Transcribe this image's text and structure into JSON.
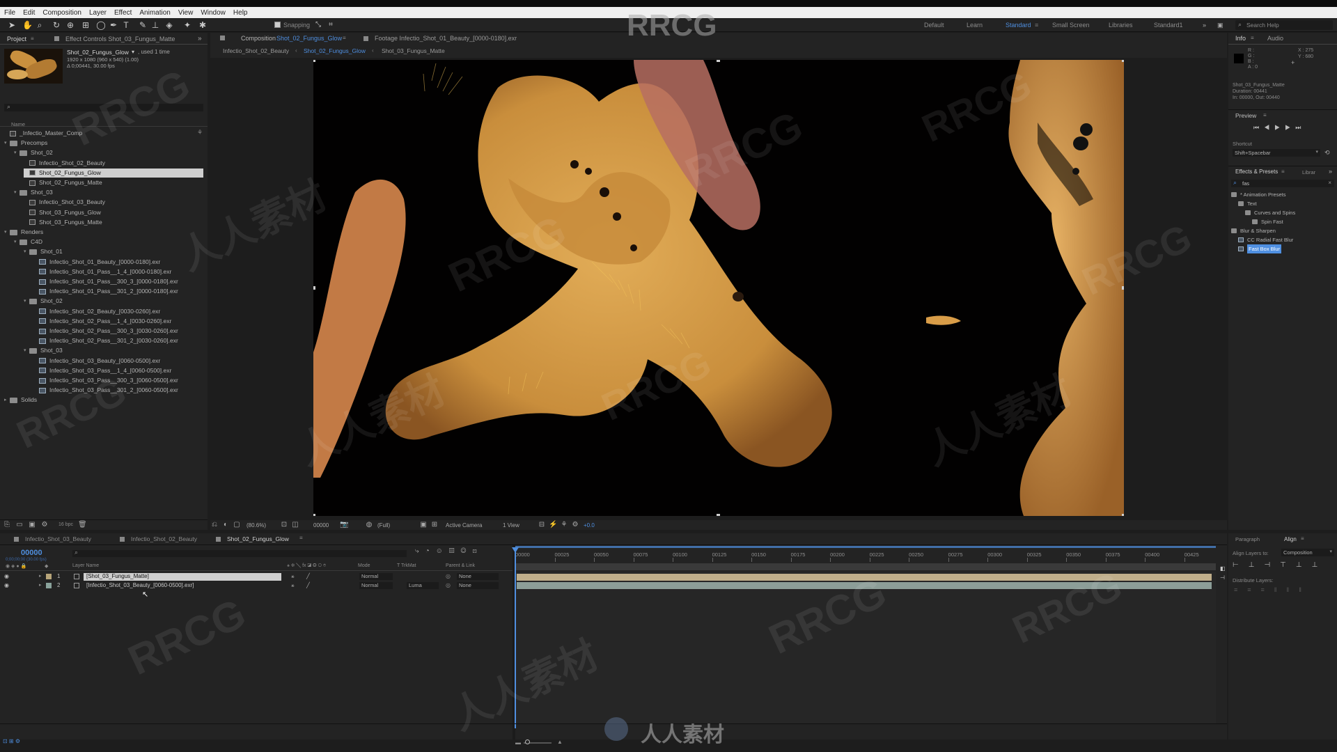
{
  "menu": [
    "File",
    "Edit",
    "Composition",
    "Layer",
    "Effect",
    "Animation",
    "View",
    "Window",
    "Help"
  ],
  "toolbar": {
    "snapping_label": "Snapping",
    "workspaces": [
      "Default",
      "Learn",
      "Standard",
      "Small Screen",
      "Libraries",
      "Standard1"
    ],
    "active_workspace": "Standard",
    "search_help_placeholder": "Search Help"
  },
  "project_panel": {
    "tab_project": "Project",
    "tab_effect_controls": "Effect Controls Shot_03_Fungus_Matte",
    "selected_item": {
      "name": "Shot_02_Fungus_Glow",
      "used": ", used 1 time",
      "dims": "1920 x 1080  (960 x 540) (1.00)",
      "duration": "Δ 0;00441, 30.00 fps"
    },
    "column_name": "Name",
    "items": [
      {
        "label": "_Infectio_Master_Comp",
        "kind": "comp",
        "indent": 0
      },
      {
        "label": "Precomps",
        "kind": "folder",
        "indent": 0,
        "open": true
      },
      {
        "label": "Shot_02",
        "kind": "folder",
        "indent": 1,
        "open": true
      },
      {
        "label": "Infectio_Shot_02_Beauty",
        "kind": "comp",
        "indent": 2
      },
      {
        "label": "Shot_02_Fungus_Glow",
        "kind": "comp",
        "indent": 2,
        "selected": true
      },
      {
        "label": "Shot_02_Fungus_Matte",
        "kind": "comp",
        "indent": 2
      },
      {
        "label": "Shot_03",
        "kind": "folder",
        "indent": 1,
        "open": true
      },
      {
        "label": "Infectio_Shot_03_Beauty",
        "kind": "comp",
        "indent": 2
      },
      {
        "label": "Shot_03_Fungus_Glow",
        "kind": "comp",
        "indent": 2
      },
      {
        "label": "Shot_03_Fungus_Matte",
        "kind": "comp",
        "indent": 2
      },
      {
        "label": "Renders",
        "kind": "folder",
        "indent": 0,
        "open": true
      },
      {
        "label": "C4D",
        "kind": "folder",
        "indent": 1,
        "open": true
      },
      {
        "label": "Shot_01",
        "kind": "folder",
        "indent": 2,
        "open": true
      },
      {
        "label": "Infectio_Shot_01_Beauty_[0000-0180].exr",
        "kind": "exr",
        "indent": 3
      },
      {
        "label": "Infectio_Shot_01_Pass__1_4_[0000-0180].exr",
        "kind": "exr",
        "indent": 3
      },
      {
        "label": "Infectio_Shot_01_Pass__300_3_[0000-0180].exr",
        "kind": "exr",
        "indent": 3
      },
      {
        "label": "Infectio_Shot_01_Pass__301_2_[0000-0180].exr",
        "kind": "exr",
        "indent": 3
      },
      {
        "label": "Shot_02",
        "kind": "folder",
        "indent": 2,
        "open": true
      },
      {
        "label": "Infectio_Shot_02_Beauty_[0030-0260].exr",
        "kind": "exr",
        "indent": 3
      },
      {
        "label": "Infectio_Shot_02_Pass__1_4_[0030-0260].exr",
        "kind": "exr",
        "indent": 3
      },
      {
        "label": "Infectio_Shot_02_Pass__300_3_[0030-0260].exr",
        "kind": "exr",
        "indent": 3
      },
      {
        "label": "Infectio_Shot_02_Pass__301_2_[0030-0260].exr",
        "kind": "exr",
        "indent": 3
      },
      {
        "label": "Shot_03",
        "kind": "folder",
        "indent": 2,
        "open": true
      },
      {
        "label": "Infectio_Shot_03_Beauty_[0060-0500].exr",
        "kind": "exr",
        "indent": 3
      },
      {
        "label": "Infectio_Shot_03_Pass__1_4_[0060-0500].exr",
        "kind": "exr",
        "indent": 3
      },
      {
        "label": "Infectio_Shot_03_Pass__300_3_[0060-0500].exr",
        "kind": "exr",
        "indent": 3
      },
      {
        "label": "Infectio_Shot_03_Pass__301_2_[0060-0500].exr",
        "kind": "exr",
        "indent": 3
      },
      {
        "label": "Solids",
        "kind": "folder",
        "indent": 0,
        "open": false
      }
    ],
    "bpc": "16 bpc"
  },
  "comp_panel": {
    "tab_comp_prefix": "Composition",
    "tab_comp_name": "Shot_02_Fungus_Glow",
    "tab_footage": "Footage Infectio_Shot_01_Beauty_[0000-0180].exr",
    "breadcrumbs": [
      "Infectio_Shot_02_Beauty",
      "Shot_02_Fungus_Glow",
      "Shot_03_Fungus_Matte"
    ],
    "zoom": "(80.6%)",
    "timecode": "00000",
    "resolution": "(Full)",
    "camera": "Active Camera",
    "views": "1 View",
    "exposure": "+0.0"
  },
  "info_panel": {
    "tab_info": "Info",
    "tab_audio": "Audio",
    "channels": [
      "R :",
      "G :",
      "B :",
      "A : 0"
    ],
    "coords_x": "X : 275",
    "coords_y": "Y : 680",
    "layer_name": "Shot_03_Fungus_Matte",
    "duration": "Duration: 00441",
    "in_out": "In: 00000, Out: 00440"
  },
  "preview_panel": {
    "title": "Preview",
    "shortcut_label": "Shortcut",
    "shortcut_value": "Shift+Spacebar"
  },
  "effects_panel": {
    "tab": "Effects & Presets",
    "tab2": "Librar",
    "search_value": "fas",
    "tree": [
      {
        "label": "* Animation Presets",
        "indent": 0
      },
      {
        "label": "Text",
        "indent": 1
      },
      {
        "label": "Curves and Spins",
        "indent": 2
      },
      {
        "label": "Spin Fast",
        "indent": 3
      },
      {
        "label": "Blur & Sharpen",
        "indent": 0
      },
      {
        "label": "CC Radial Fast Blur",
        "indent": 1
      },
      {
        "label": "Fast Box Blur",
        "indent": 1,
        "selected": true
      }
    ]
  },
  "align_panel": {
    "tab_paragraph": "Paragraph",
    "tab_align": "Align",
    "align_layers_to": "Align Layers to:",
    "align_target": "Composition",
    "distribute_label": "Distribute Layers:"
  },
  "timeline": {
    "tabs": [
      "Infectio_Shot_03_Beauty",
      "Infectio_Shot_02_Beauty",
      "Shot_02_Fungus_Glow"
    ],
    "active_tab": "Shot_02_Fungus_Glow",
    "current_time": "00000",
    "time_sub": "0;00;00;00 (30.00 fps)",
    "col_layer_name": "Layer Name",
    "col_mode": "Mode",
    "col_trkmat": "T TrkMat",
    "col_parent": "Parent & Link",
    "layers": [
      {
        "num": "1",
        "name": "[Shot_03_Fungus_Matte]",
        "mode": "Normal",
        "trkmat": "",
        "parent": "None"
      },
      {
        "num": "2",
        "name": "[Infectio_Shot_03_Beauty_[0060-0500].exr]",
        "mode": "Normal",
        "trkmat": "Luma",
        "parent": "None"
      }
    ],
    "ruler": [
      "00000",
      "00025",
      "00050",
      "00075",
      "00100",
      "00125",
      "00150",
      "00175",
      "00200",
      "00225",
      "00250",
      "00275",
      "00300",
      "00325",
      "00350",
      "00375",
      "00400",
      "00425"
    ]
  },
  "watermark": {
    "brand": "RRCG",
    "cn": "人人素材"
  },
  "colors": {
    "accent": "#4f8fe0",
    "fungus": "#d9a24a",
    "layer_bar": "#bfae8a",
    "layer_bar2": "#8c9e98"
  }
}
